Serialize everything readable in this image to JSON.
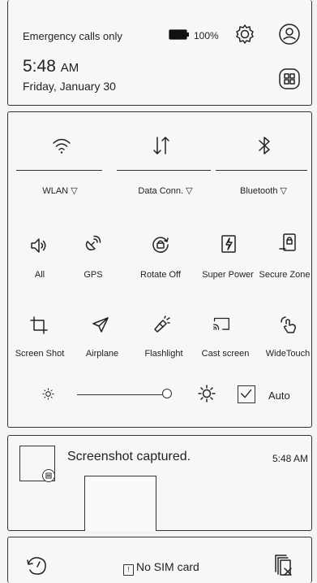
{
  "status": {
    "carrier": "Emergency calls only",
    "battery": "100%",
    "time": "5:48",
    "ampm": "AM",
    "date": "Friday, January 30"
  },
  "toggles": [
    {
      "label": "WLAN",
      "icon": "wifi-icon"
    },
    {
      "label": "Data Conn.",
      "icon": "data-arrows-icon"
    },
    {
      "label": "Bluetooth",
      "icon": "bluetooth-icon"
    }
  ],
  "tiles_row1": [
    {
      "label": "All",
      "icon": "sound-icon"
    },
    {
      "label": "GPS",
      "icon": "gps-icon"
    },
    {
      "label": "Rotate Off",
      "icon": "rotate-lock-icon"
    },
    {
      "label": "Super Power",
      "icon": "super-power-icon"
    },
    {
      "label": "Secure Zone",
      "icon": "secure-zone-icon"
    }
  ],
  "tiles_row2": [
    {
      "label": "Screen Shot",
      "icon": "crop-icon"
    },
    {
      "label": "Airplane",
      "icon": "airplane-icon"
    },
    {
      "label": "Flashlight",
      "icon": "flashlight-icon"
    },
    {
      "label": "Cast screen",
      "icon": "cast-icon"
    },
    {
      "label": "WideTouch",
      "icon": "wide-touch-icon"
    }
  ],
  "brightness": {
    "auto_label": "Auto",
    "level": 0.9
  },
  "notification": {
    "title": "Screenshot captured.",
    "time": "5:48 AM"
  },
  "bottom": {
    "sim_status": "No SIM card"
  }
}
